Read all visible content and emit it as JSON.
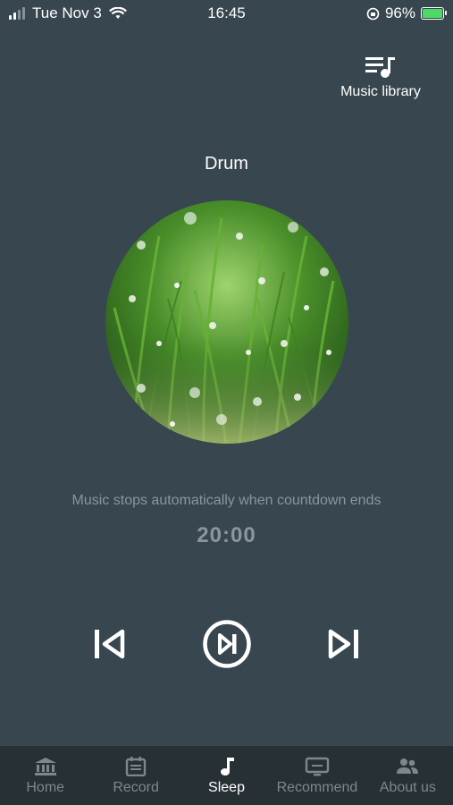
{
  "status": {
    "carrier_date": "Tue Nov 3",
    "time": "16:45",
    "battery": "96%"
  },
  "header": {
    "library_label": "Music library"
  },
  "player": {
    "title": "Drum",
    "countdown_note": "Music stops automatically when countdown ends",
    "countdown": "20:00",
    "controls": [
      "previous-icon",
      "play-pause-icon",
      "next-icon"
    ]
  },
  "tabs": [
    {
      "label": "Home",
      "icon": "bank-icon"
    },
    {
      "label": "Record",
      "icon": "calendar-icon"
    },
    {
      "label": "Sleep",
      "icon": "music-note-icon",
      "active": true
    },
    {
      "label": "Recommend",
      "icon": "tv-icon"
    },
    {
      "label": "About us",
      "icon": "people-icon"
    }
  ],
  "colors": {
    "background": "#37464f",
    "tabbar": "#263035",
    "muted": "#8a969c",
    "battery": "#4cd964"
  }
}
